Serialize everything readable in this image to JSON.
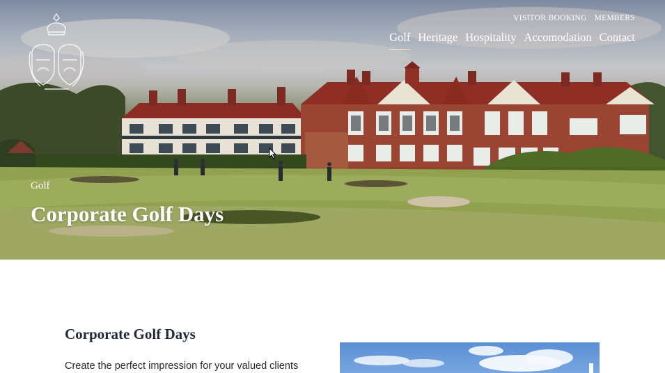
{
  "header": {
    "logo_icon": "royal-crest-logo-icon",
    "utility_nav": [
      "VISITOR BOOKING",
      "MEMBERS"
    ],
    "main_nav": [
      "Golf",
      "Heritage",
      "Hospitality",
      "Accomodation",
      "Contact"
    ],
    "active_nav": "Golf"
  },
  "hero": {
    "breadcrumb": "Golf",
    "title": "Corporate Golf Days"
  },
  "content": {
    "title": "Corporate Golf Days",
    "intro": "Create the perfect impression for your valued clients"
  },
  "colors": {
    "heading": "#1f2a36",
    "body_text": "#24292f",
    "nav_active_underline": "#f4e9c4"
  }
}
